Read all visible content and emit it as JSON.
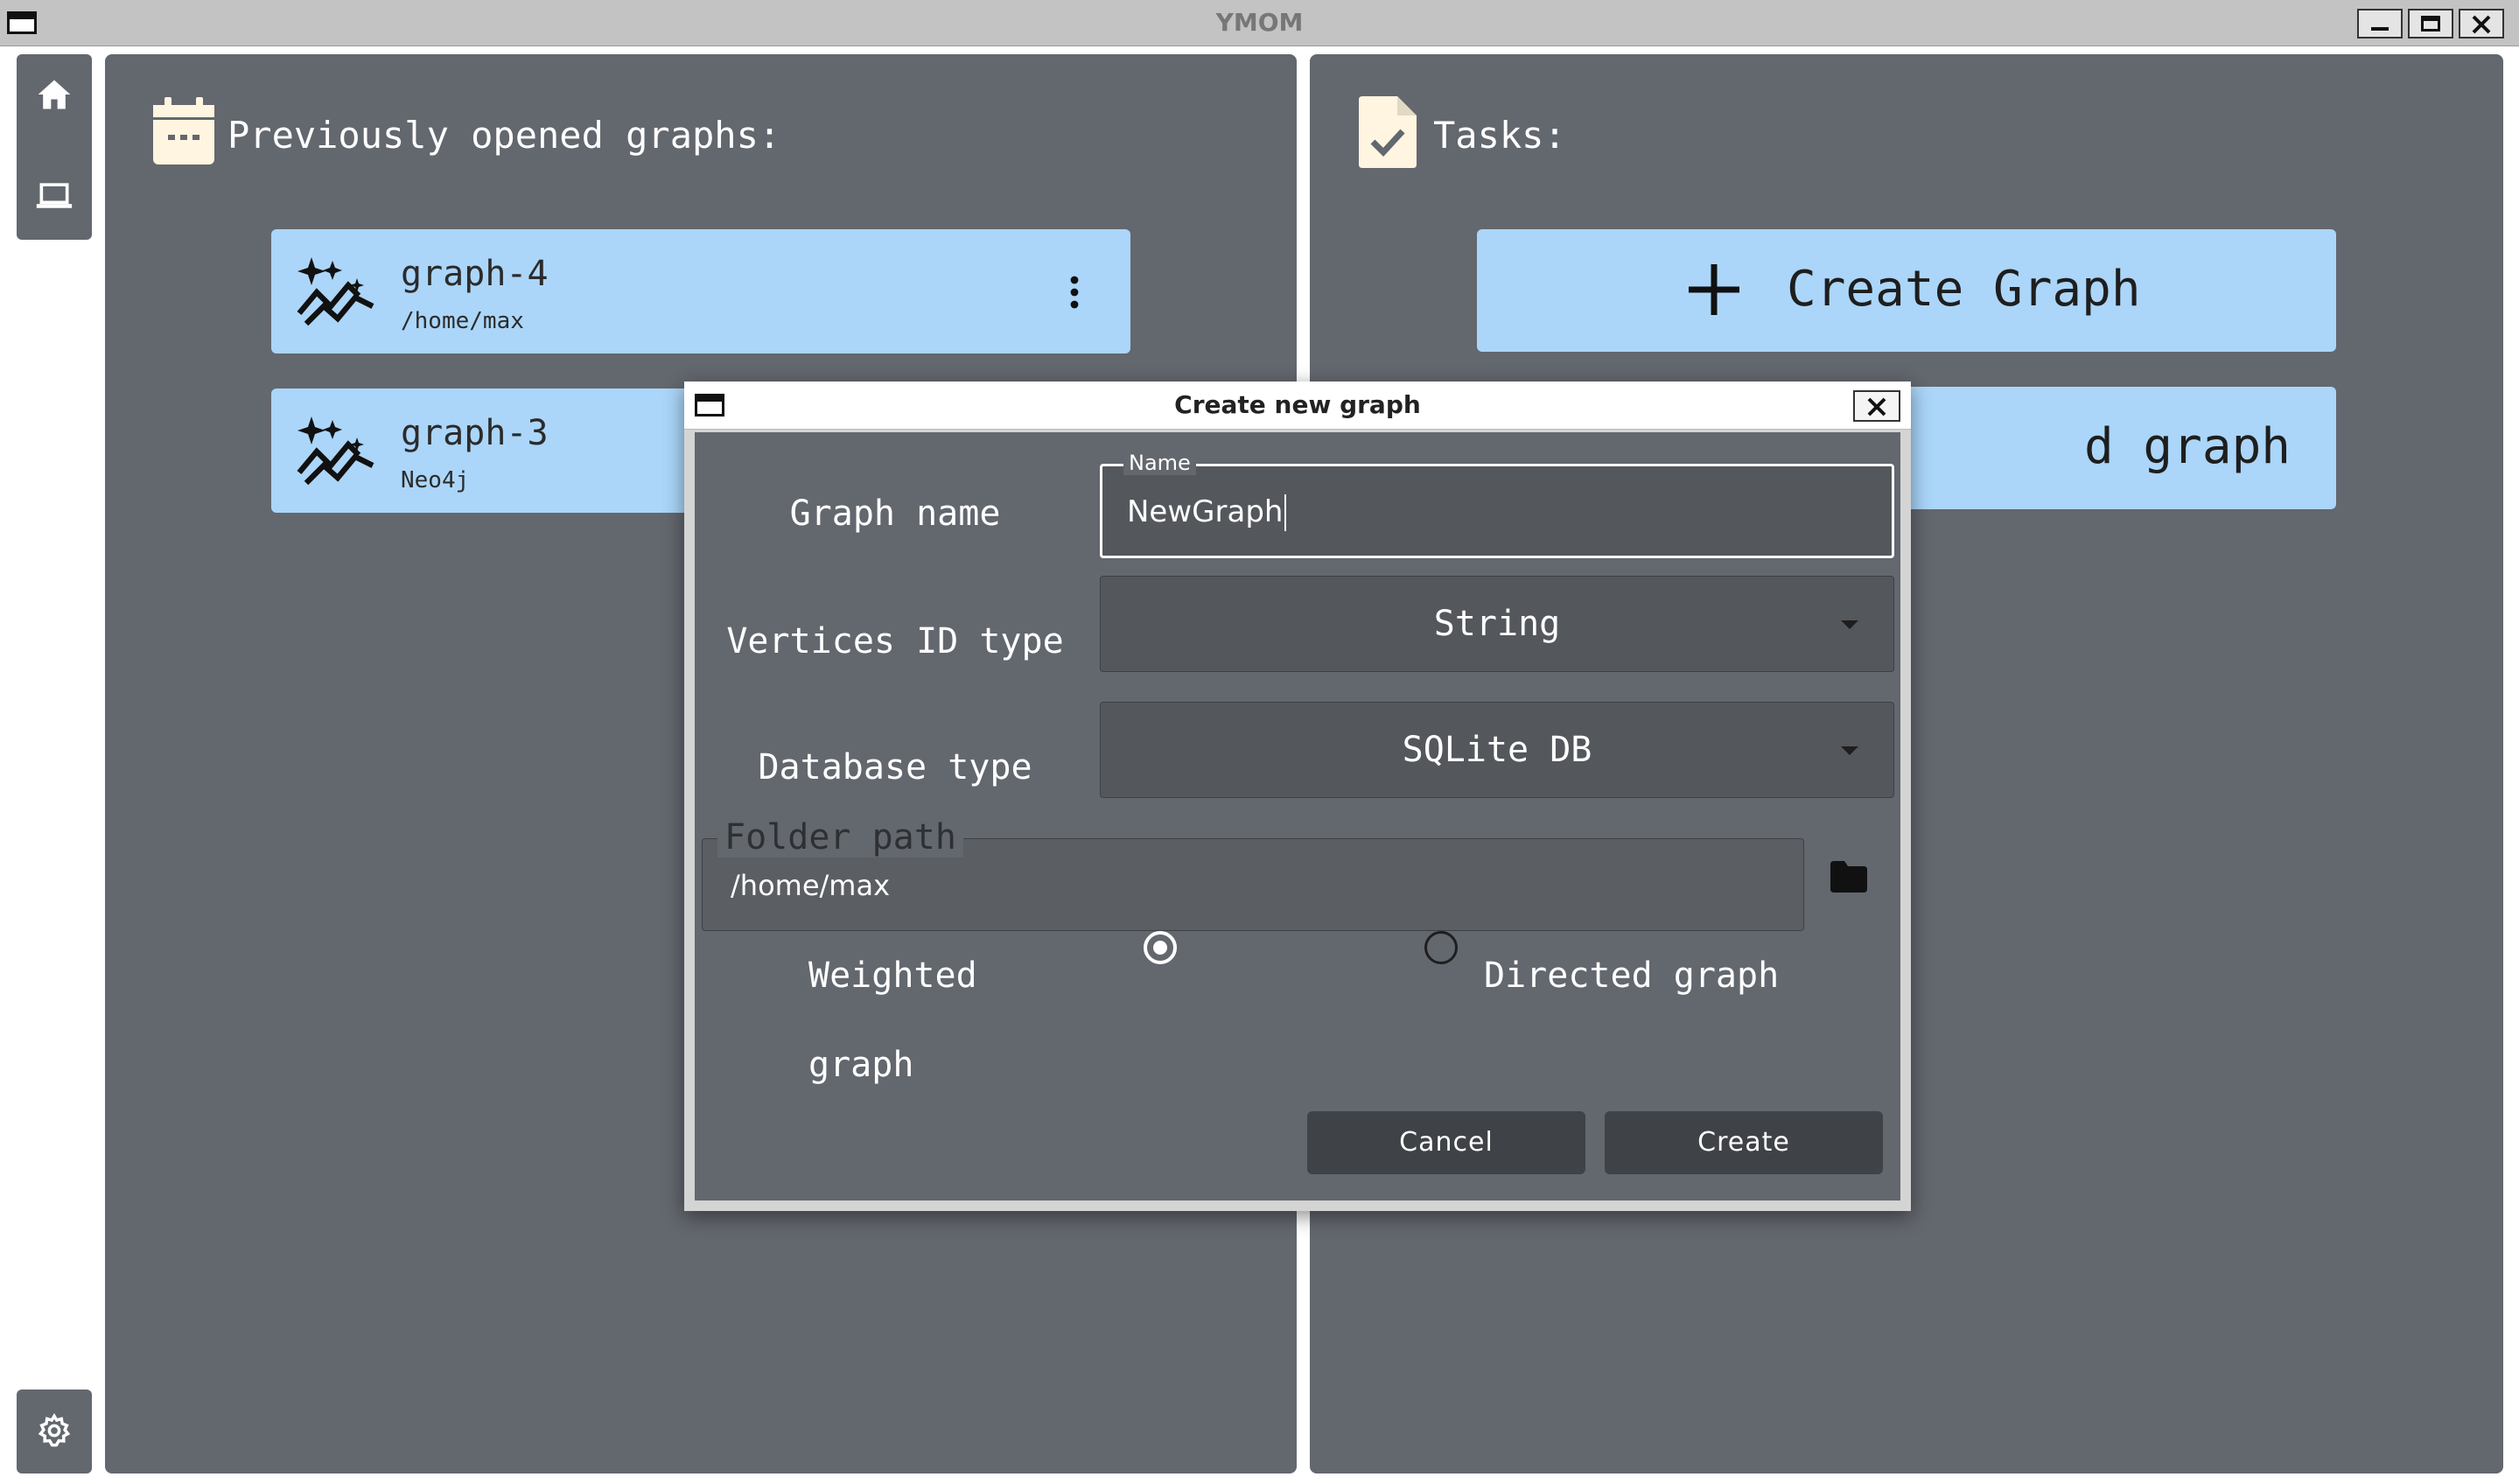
{
  "window": {
    "title": "YMOM"
  },
  "nav": {
    "items": [
      "home",
      "computer"
    ],
    "settings": "settings"
  },
  "left_panel": {
    "heading": "Previously opened graphs:",
    "graphs": [
      {
        "name": "graph-4",
        "location": "/home/max"
      },
      {
        "name": "graph-3",
        "location": "Neo4j"
      }
    ]
  },
  "right_panel": {
    "heading": "Tasks:",
    "create_label": "Create Graph",
    "second_label": "d graph"
  },
  "dialog": {
    "title": "Create new graph",
    "graph_name_label": "Graph name",
    "name_field_label": "Name",
    "name_value": "NewGraph",
    "vertices_label": "Vertices ID type",
    "vertices_value": "String",
    "database_label": "Database type",
    "database_value": "SQLite DB",
    "folder_label": "Folder path",
    "folder_value": "/home/max",
    "weighted_label": "Weighted graph",
    "weighted_selected": true,
    "directed_label": "Directed graph",
    "directed_selected": false,
    "cancel_label": "Cancel",
    "create_label": "Create"
  },
  "colors": {
    "panel": "#63676e",
    "card": "#abd6f9",
    "field": "#54575c",
    "button": "#3f4246"
  }
}
